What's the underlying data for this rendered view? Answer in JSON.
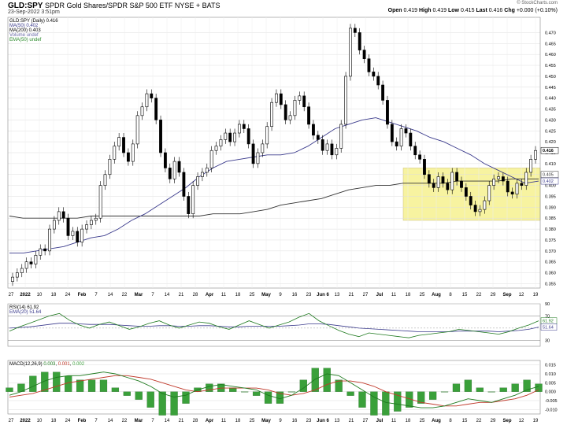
{
  "header": {
    "symbol": "GLD:SPY",
    "description": "SPDR Gold Shares/SPDR S&P 500 ETF",
    "exchange": "NYSE + BATS",
    "date": "23-Sep-2022 3:51pm",
    "brand": "© StockCharts.com",
    "quote": {
      "open": "0.419",
      "high": "0.419",
      "low": "0.415",
      "last": "0.416",
      "change": "+0.000 (+0.10%)"
    }
  },
  "legend": {
    "main": [
      "GLD:SPY (Daily) 0.416",
      "MA(50) 0.402",
      "MA(200) 0.403",
      "Volume undef",
      "EMA(50) undef"
    ],
    "rsi": [
      "RSI(14) 61.92",
      "EMA(20) 51.64"
    ],
    "macd": [
      "MACD(12,26,9)",
      "0.003",
      "0.001",
      "0.002"
    ]
  },
  "colors": {
    "up": "#ffffff",
    "down": "#000000",
    "ma50": "#3a3a8c",
    "ma200": "#333333",
    "rsi": "#1f7a1f",
    "rsi_ema": "#3a3a8c",
    "macd": "#1f7a1f",
    "signal": "#c0392b",
    "hist": "#3aa03a",
    "highlight": "#f7f3a0",
    "grid": "#dddddd"
  },
  "chart_data": [
    {
      "type": "candlestick",
      "title": "GLD:SPY (Daily)",
      "x_labels": [
        "27",
        "2022",
        "10",
        "18",
        "24",
        "Feb",
        "7",
        "14",
        "22",
        "Mar",
        "7",
        "14",
        "21",
        "28",
        "Apr",
        "11",
        "18",
        "25",
        "May",
        "9",
        "16",
        "23",
        "Jun 6",
        "13",
        "21",
        "27",
        "Jul",
        "11",
        "18",
        "25",
        "Aug",
        "8",
        "15",
        "22",
        "29",
        "Sep",
        "12",
        "19"
      ],
      "y_ticks": [
        0.355,
        0.36,
        0.365,
        0.37,
        0.375,
        0.38,
        0.385,
        0.39,
        0.395,
        0.4,
        0.405,
        0.41,
        0.415,
        0.42,
        0.425,
        0.43,
        0.435,
        0.44,
        0.445,
        0.45,
        0.455,
        0.46,
        0.465,
        0.47
      ],
      "ylim": [
        0.353,
        0.477
      ],
      "last_labels": [
        "0.416",
        "0.405",
        "0.402"
      ],
      "closes": [
        0.358,
        0.36,
        0.362,
        0.365,
        0.364,
        0.368,
        0.371,
        0.37,
        0.38,
        0.384,
        0.388,
        0.385,
        0.377,
        0.379,
        0.374,
        0.38,
        0.382,
        0.384,
        0.385,
        0.4,
        0.405,
        0.412,
        0.418,
        0.422,
        0.415,
        0.411,
        0.419,
        0.432,
        0.436,
        0.442,
        0.44,
        0.43,
        0.415,
        0.408,
        0.403,
        0.411,
        0.406,
        0.395,
        0.387,
        0.4,
        0.404,
        0.406,
        0.408,
        0.416,
        0.418,
        0.421,
        0.424,
        0.42,
        0.424,
        0.428,
        0.426,
        0.419,
        0.41,
        0.415,
        0.419,
        0.427,
        0.438,
        0.442,
        0.437,
        0.43,
        0.432,
        0.439,
        0.441,
        0.436,
        0.428,
        0.423,
        0.421,
        0.416,
        0.419,
        0.414,
        0.417,
        0.428,
        0.45,
        0.472,
        0.47,
        0.462,
        0.458,
        0.452,
        0.45,
        0.446,
        0.439,
        0.428,
        0.42,
        0.418,
        0.426,
        0.424,
        0.418,
        0.414,
        0.412,
        0.405,
        0.401,
        0.399,
        0.404,
        0.401,
        0.398,
        0.406,
        0.402,
        0.399,
        0.395,
        0.391,
        0.388,
        0.389,
        0.393,
        0.4,
        0.403,
        0.404,
        0.402,
        0.397,
        0.396,
        0.401,
        0.4,
        0.406,
        0.412,
        0.416
      ],
      "ma50": [
        0.369,
        0.369,
        0.37,
        0.371,
        0.372,
        0.374,
        0.376,
        0.377,
        0.38,
        0.384,
        0.387,
        0.391,
        0.395,
        0.399,
        0.404,
        0.408,
        0.411,
        0.412,
        0.413,
        0.414,
        0.414,
        0.415,
        0.418,
        0.422,
        0.426,
        0.428,
        0.43,
        0.431,
        0.429,
        0.427,
        0.425,
        0.422,
        0.42,
        0.417,
        0.414,
        0.41,
        0.407,
        0.404,
        0.401,
        0.402
      ],
      "ma200": [
        0.386,
        0.385,
        0.385,
        0.385,
        0.385,
        0.385,
        0.386,
        0.386,
        0.386,
        0.386,
        0.386,
        0.386,
        0.386,
        0.386,
        0.386,
        0.387,
        0.387,
        0.387,
        0.388,
        0.389,
        0.391,
        0.392,
        0.393,
        0.394,
        0.396,
        0.398,
        0.399,
        0.4,
        0.4,
        0.401,
        0.401,
        0.401,
        0.401,
        0.402,
        0.402,
        0.402,
        0.402,
        0.403,
        0.403,
        0.403
      ]
    },
    {
      "type": "line",
      "title": "RSI(14)",
      "ylim": [
        20,
        90
      ],
      "y_ticks": [
        30,
        70,
        90
      ],
      "last_labels": [
        "61.92",
        "51.64"
      ],
      "series": [
        {
          "name": "RSI(14)",
          "values": [
            45,
            52,
            58,
            64,
            70,
            74,
            63,
            55,
            50,
            56,
            60,
            54,
            48,
            52,
            58,
            62,
            55,
            50,
            55,
            60,
            58,
            52,
            48,
            55,
            62,
            56,
            50,
            55,
            60,
            68,
            74,
            62,
            54,
            46,
            40,
            36,
            42,
            40,
            38,
            36,
            34,
            38,
            40,
            42,
            44,
            48,
            46,
            44,
            42,
            40,
            44,
            50,
            55,
            62
          ]
        },
        {
          "name": "EMA(20)",
          "values": [
            50,
            51,
            52,
            54,
            56,
            58,
            58,
            57,
            56,
            56,
            56,
            55,
            54,
            53,
            53,
            54,
            54,
            53,
            53,
            54,
            54,
            53,
            52,
            52,
            53,
            53,
            53,
            53,
            54,
            55,
            57,
            57,
            56,
            54,
            52,
            50,
            49,
            48,
            47,
            46,
            45,
            44,
            44,
            44,
            44,
            45,
            45,
            45,
            45,
            44,
            45,
            46,
            48,
            51.64
          ]
        }
      ]
    },
    {
      "type": "line",
      "title": "MACD(12,26,9)",
      "ylim": [
        -0.0125,
        0.0175
      ],
      "y_ticks": [
        -0.01,
        -0.005,
        0.0,
        0.005,
        0.01,
        0.015
      ],
      "series": [
        {
          "name": "MACD",
          "values": [
            -0.002,
            0.0,
            0.003,
            0.006,
            0.008,
            0.009,
            0.009,
            0.01,
            0.011,
            0.01,
            0.008,
            0.006,
            0.003,
            -0.001,
            -0.003,
            -0.002,
            0.001,
            0.003,
            0.004,
            0.003,
            0.002,
            0.001,
            -0.002,
            -0.004,
            -0.002,
            0.002,
            0.007,
            0.01,
            0.009,
            0.005,
            0.001,
            -0.003,
            -0.006,
            -0.007,
            -0.008,
            -0.009,
            -0.009,
            -0.008,
            -0.006,
            -0.004,
            -0.005,
            -0.006,
            -0.004,
            -0.002,
            0.001,
            0.003
          ]
        },
        {
          "name": "Signal",
          "values": [
            -0.003,
            -0.002,
            -0.001,
            0.001,
            0.003,
            0.005,
            0.006,
            0.007,
            0.008,
            0.009,
            0.009,
            0.008,
            0.007,
            0.005,
            0.003,
            0.001,
            0.0,
            0.001,
            0.002,
            0.002,
            0.002,
            0.002,
            0.001,
            -0.001,
            -0.002,
            -0.001,
            0.001,
            0.004,
            0.006,
            0.006,
            0.005,
            0.003,
            0.0,
            -0.002,
            -0.004,
            -0.006,
            -0.007,
            -0.008,
            -0.008,
            -0.007,
            -0.006,
            -0.006,
            -0.005,
            -0.004,
            -0.002,
            0.001
          ]
        }
      ]
    }
  ]
}
